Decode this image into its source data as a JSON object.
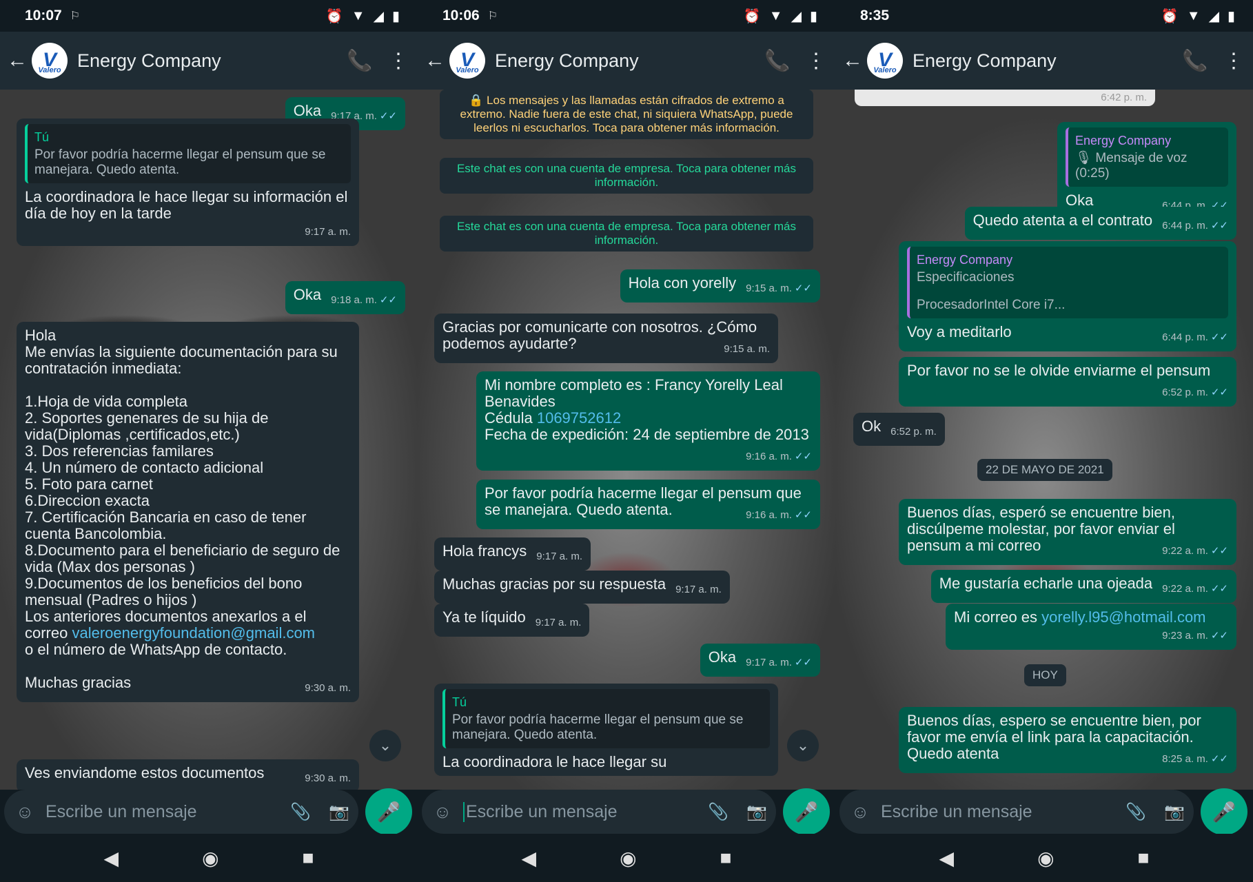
{
  "contact_name": "Energy Company",
  "avatar_text": "Valero",
  "input_placeholder": "Escribe un mensaje",
  "you_label": "Tú",
  "screens": [
    {
      "status_time": "10:07",
      "messages": {
        "m1": {
          "text": "Oka",
          "time": "9:17 a. m."
        },
        "m2": {
          "quote": "Por favor podría hacerme llegar el pensum que se manejara. Quedo atenta.",
          "text": "La coordinadora le hace llegar su información el día de hoy en la tarde",
          "time": "9:17 a. m."
        },
        "m3": {
          "text": "Oka",
          "time": "9:18 a. m."
        },
        "m4": {
          "lines": [
            "Hola",
            "Me envías la siguiente documentación para su contratación inmediata:",
            "",
            "1.Hoja de vida completa",
            "2. Soportes genenares de su hija de vida(Diplomas ,certificados,etc.)",
            "3. Dos referencias familares",
            "4. Un  número de contacto adicional",
            "5. Foto para carnet",
            "6.Direccion exacta",
            "7. Certificación Bancaria en caso de tener cuenta Bancolombia.",
            "8.Documento para el beneficiario de seguro de vida (Max dos personas )",
            "9.Documentos de los beneficios del bono mensual (Padres o hijos )",
            "Los anteriores documentos anexarlos a el correo"
          ],
          "email": "valeroenergyfoundation@gmail.com",
          "after": "o el número de WhatsApp de contacto.",
          "closing": "Muchas gracias",
          "time": "9:30 a. m."
        },
        "m5": {
          "text": "Ves enviandome estos documentos",
          "time": "9:30 a. m."
        }
      }
    },
    {
      "status_time": "10:06",
      "messages": {
        "sys1": "Los mensajes y las llamadas están cifrados de extremo a extremo. Nadie fuera de este chat, ni siquiera WhatsApp, puede leerlos ni escucharlos. Toca para obtener más información.",
        "sys2": "Este chat es con una cuenta de empresa. Toca para obtener más información.",
        "sys3": "Este chat es con una cuenta de empresa. Toca para obtener más información.",
        "m1": {
          "text": "Hola con yorelly",
          "time": "9:15 a. m."
        },
        "m2": {
          "text": "Gracias por comunicarte con nosotros. ¿Cómo podemos ayudarte?",
          "time": "9:15 a. m."
        },
        "m3": {
          "line1": "Mi nombre completo es : Francy Yorelly Leal Benavides",
          "cedula_label": "Cédula",
          "cedula": "1069752612",
          "line3": "Fecha de expedición: 24 de septiembre de 2013",
          "time": "9:16 a. m."
        },
        "m4": {
          "text": "Por favor podría hacerme llegar el pensum que se manejara. Quedo atenta.",
          "time": "9:16 a. m."
        },
        "m5": {
          "text": "Hola francys",
          "time": "9:17 a. m."
        },
        "m6": {
          "text": "Muchas gracias por su respuesta",
          "time": "9:17 a. m."
        },
        "m7": {
          "text": "Ya te líquido",
          "time": "9:17 a. m."
        },
        "m8": {
          "text": "Oka",
          "time": "9:17 a. m."
        },
        "m9": {
          "quote": "Por favor podría hacerme llegar el pensum que se manejara. Quedo atenta.",
          "text": "La coordinadora le hace llegar su"
        }
      }
    },
    {
      "status_time": "8:35",
      "messages": {
        "m0": {
          "time": "6:42 p. m."
        },
        "m1": {
          "quote_who": "Energy Company",
          "quote": "Mensaje de voz (0:25)",
          "text": "Oka",
          "time": "6:44 p. m."
        },
        "m2": {
          "text": "Quedo atenta a el contrato",
          "time": "6:44 p. m."
        },
        "m3": {
          "quote_who": "Energy Company",
          "quote1": "Especificaciones",
          "quote2": "ProcesadorIntel Core i7...",
          "text": "Voy a meditarlo",
          "time": "6:44 p. m."
        },
        "m4": {
          "text": "Por favor no se le olvide enviarme el pensum",
          "time": "6:52 p. m."
        },
        "m5": {
          "text": "Ok",
          "time": "6:52 p. m."
        },
        "date1": "22 DE MAYO DE 2021",
        "m6": {
          "text": "Buenos días, esperó se encuentre bien, discúlpeme molestar, por favor enviar el pensum a mi correo",
          "time": "9:22 a. m."
        },
        "m7": {
          "text": "Me gustaría echarle una ojeada",
          "time": "9:22 a. m."
        },
        "m8": {
          "text": "Mi correo es",
          "email": "yorelly.l95@hotmail.com",
          "time": "9:23 a. m."
        },
        "date2": "HOY",
        "m9": {
          "text": "Buenos días, espero se encuentre bien, por favor me envía el link para la capacitación. Quedo atenta",
          "time": "8:25 a. m."
        }
      }
    }
  ],
  "icons": {
    "back": "arrow-left",
    "call": "add-call",
    "menu": "more-vertical",
    "emoji": "emoji",
    "attach": "paperclip",
    "camera": "camera",
    "mic": "microphone"
  },
  "colors": {
    "outgoing": "#005c4b",
    "incoming": "#202c33",
    "accent": "#00a884"
  }
}
